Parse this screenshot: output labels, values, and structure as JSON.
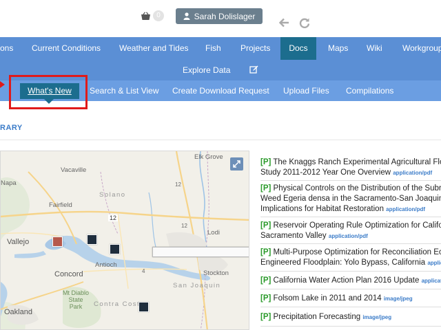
{
  "header": {
    "cart_count": "0",
    "user_name": "Sarah Dolislager"
  },
  "main_nav": {
    "items": [
      {
        "label": "ons"
      },
      {
        "label": "Current Conditions"
      },
      {
        "label": "Weather and Tides"
      },
      {
        "label": "Fish"
      },
      {
        "label": "Projects"
      },
      {
        "label": "Docs",
        "active": true
      },
      {
        "label": "Maps"
      },
      {
        "label": "Wiki"
      },
      {
        "label": "Workgroup"
      }
    ],
    "active_color": "#1c6d8e",
    "bar_color": "#5b8fd5"
  },
  "explore_nav": {
    "label": "Explore Data"
  },
  "sub_nav": {
    "items": [
      {
        "label": "What's New",
        "active": true
      },
      {
        "label": "Search & List View"
      },
      {
        "label": "Create Download Request"
      },
      {
        "label": "Upload Files"
      },
      {
        "label": "Compilations"
      }
    ],
    "highlight_color": "#e01a1a"
  },
  "section": {
    "title": "RARY"
  },
  "map": {
    "labels": {
      "elk_grove": "Elk Grove",
      "vacaville": "Vacaville",
      "napa": "Napa",
      "fairfield": "Fairfield",
      "solano": "Solano",
      "lodi": "Lodi",
      "vallejo": "Vallejo",
      "antioch": "Antioch",
      "stockton": "Stockton",
      "concord": "Concord",
      "san_joaquin": "San Joaquin",
      "mt_diablo": "Mt Diablo\nState\nPark",
      "contra_costa": "Contra Costa",
      "oakland": "Oakland",
      "route_12_a": "12",
      "route_12_b": "12",
      "route_4": "4",
      "cluster_count": "12"
    }
  },
  "documents": [
    {
      "tag": "[P]",
      "line1": "The Knaggs Ranch Experimental Agricultural Flo",
      "line2": "Study 2011-2012 Year One Overview",
      "mime": "application/pdf"
    },
    {
      "tag": "[P]",
      "line1": "Physical Controls on the Distribution of the Subr",
      "line2": "Weed Egeria densa in the Sacramento-San Joaquin",
      "line3": "Implications for Habitat Restoration",
      "mime": "application/pdf"
    },
    {
      "tag": "[P]",
      "line1": "Reservoir Operating Rule Optimization for Califo",
      "line2": "Sacramento Valley",
      "mime": "application/pdf"
    },
    {
      "tag": "[P]",
      "line1": "Multi-Purpose Optimization for Reconciliation Ec",
      "line2": "Engineered Floodplain: Yolo Bypass, California",
      "mime": "applic"
    },
    {
      "tag": "[P]",
      "line1": "California Water Action Plan 2016 Update",
      "mime": "applicat"
    },
    {
      "tag": "[P]",
      "line1": "Folsom Lake in 2011 and 2014",
      "mime": "image/jpeg"
    },
    {
      "tag": "[P]",
      "line1": "Precipitation Forecasting",
      "mime": "image/jpeg"
    }
  ]
}
